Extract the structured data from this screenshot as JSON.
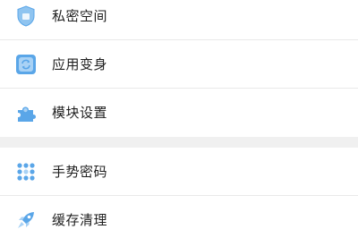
{
  "settings_list": {
    "section1": [
      {
        "label": "私密空间",
        "icon": "shield-private-icon"
      },
      {
        "label": "应用变身",
        "icon": "app-disguise-icon"
      },
      {
        "label": "模块设置",
        "icon": "puzzle-icon"
      }
    ],
    "section2": [
      {
        "label": "手势密码",
        "icon": "gesture-dots-icon"
      },
      {
        "label": "缓存清理",
        "icon": "rocket-icon"
      }
    ]
  },
  "colors": {
    "icon_blue": "#5aa6e8",
    "icon_light": "#a9d2f5",
    "text": "#1f1f1f",
    "divider": "#e9e9e9",
    "section_gap": "#f0f0f0"
  }
}
